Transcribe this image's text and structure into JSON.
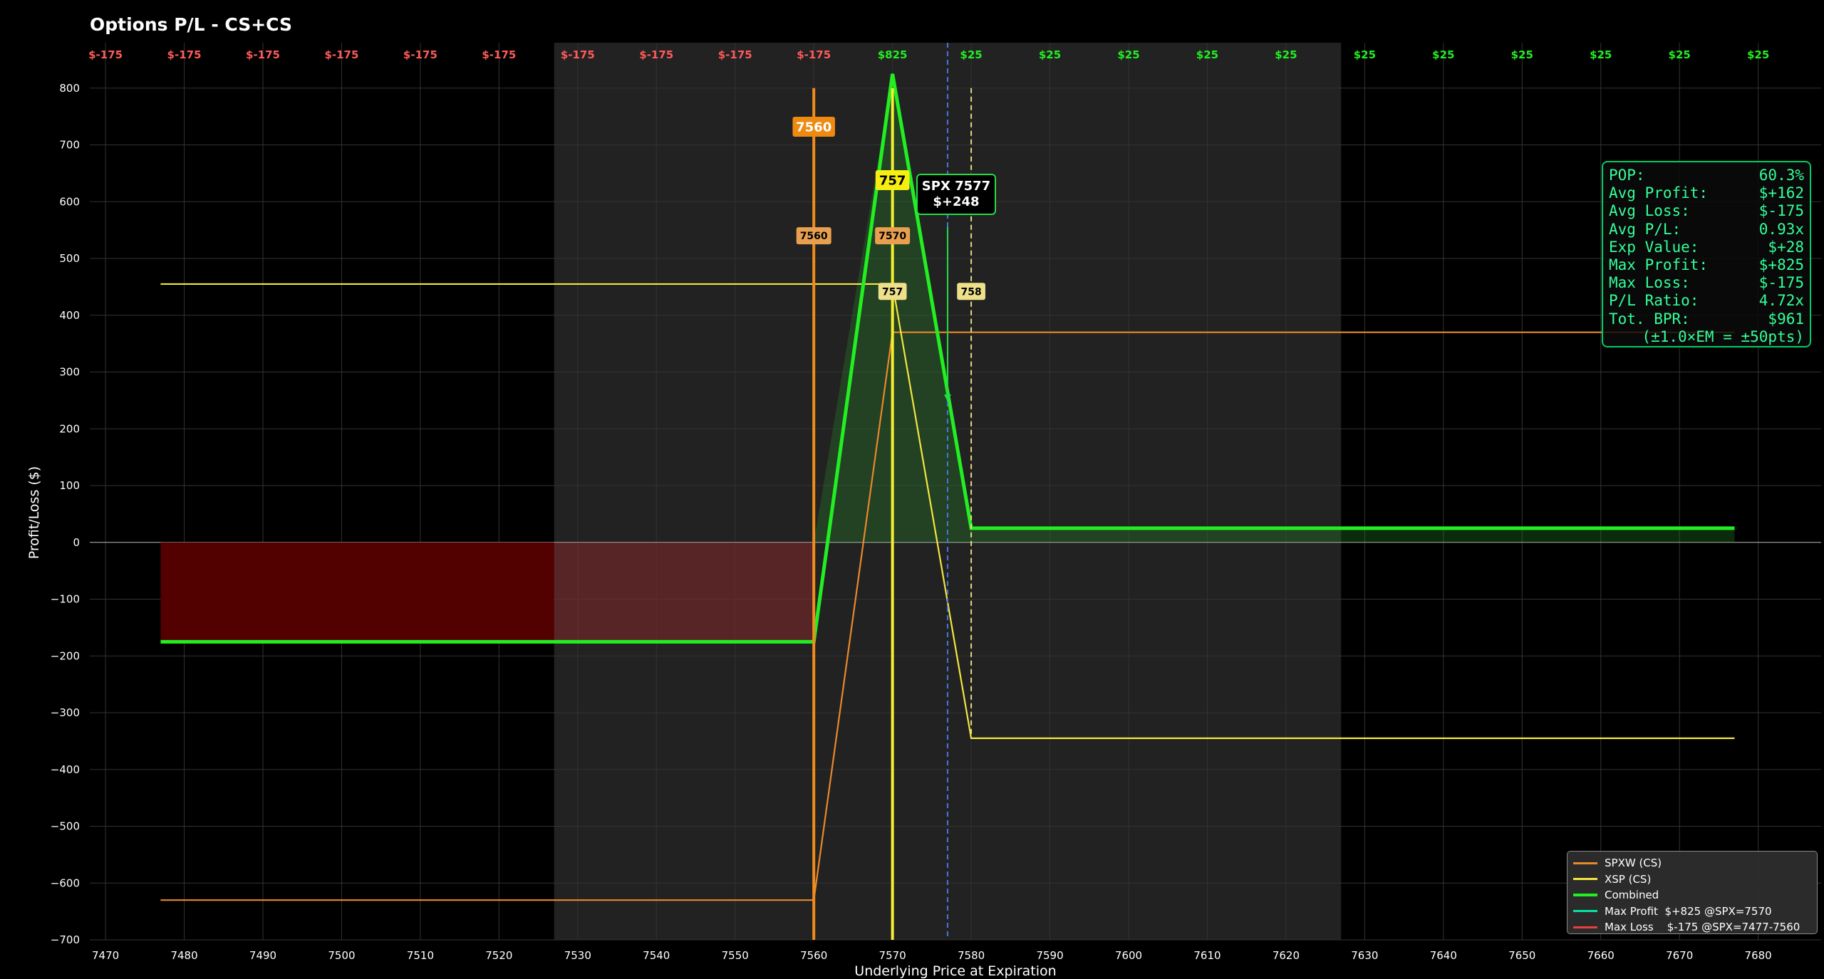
{
  "title": "Options P/L - CS+CS",
  "chart_data": {
    "type": "line",
    "xlabel": "Underlying Price at Expiration",
    "ylabel": "Profit/Loss ($)",
    "xlim": [
      7468,
      7688
    ],
    "ylim": [
      -700,
      880
    ],
    "grid": true,
    "x_ticks": [
      7470,
      7480,
      7490,
      7500,
      7510,
      7520,
      7530,
      7540,
      7550,
      7560,
      7570,
      7580,
      7590,
      7600,
      7610,
      7620,
      7630,
      7640,
      7650,
      7660,
      7670,
      7680
    ],
    "y_ticks": [
      800,
      700,
      600,
      500,
      400,
      300,
      200,
      100,
      0,
      -100,
      -200,
      -300,
      -400,
      -500,
      -600,
      -700
    ],
    "expected_move_range": [
      7527,
      7627
    ],
    "series": [
      {
        "name": "SPXW (CS)",
        "color": "#e8892a",
        "points": [
          [
            7477,
            -630
          ],
          [
            7560,
            -630
          ],
          [
            7570,
            370
          ],
          [
            7677,
            370
          ]
        ]
      },
      {
        "name": "XSP (CS)",
        "color": "#f2e640",
        "points": [
          [
            7477,
            455
          ],
          [
            7570,
            455
          ],
          [
            7580,
            -345
          ],
          [
            7677,
            -345
          ]
        ]
      },
      {
        "name": "Combined",
        "color": "#22ee22",
        "points": [
          [
            7477,
            -175
          ],
          [
            7560,
            -175
          ],
          [
            7570,
            825
          ],
          [
            7580,
            25
          ],
          [
            7677,
            25
          ]
        ]
      }
    ],
    "top_labels": [
      {
        "x": 7470,
        "text": "$-175"
      },
      {
        "x": 7480,
        "text": "$-175"
      },
      {
        "x": 7490,
        "text": "$-175"
      },
      {
        "x": 7500,
        "text": "$-175"
      },
      {
        "x": 7510,
        "text": "$-175"
      },
      {
        "x": 7520,
        "text": "$-175"
      },
      {
        "x": 7530,
        "text": "$-175"
      },
      {
        "x": 7540,
        "text": "$-175"
      },
      {
        "x": 7550,
        "text": "$-175"
      },
      {
        "x": 7560,
        "text": "$-175"
      },
      {
        "x": 7570,
        "text": "$825"
      },
      {
        "x": 7580,
        "text": "$25"
      },
      {
        "x": 7590,
        "text": "$25"
      },
      {
        "x": 7600,
        "text": "$25"
      },
      {
        "x": 7610,
        "text": "$25"
      },
      {
        "x": 7620,
        "text": "$25"
      },
      {
        "x": 7630,
        "text": "$25"
      },
      {
        "x": 7640,
        "text": "$25"
      },
      {
        "x": 7650,
        "text": "$25"
      },
      {
        "x": 7660,
        "text": "$25"
      },
      {
        "x": 7670,
        "text": "$25"
      },
      {
        "x": 7680,
        "text": "$25"
      }
    ],
    "strike_lines": [
      {
        "x": 7560,
        "color": "#f28c1e",
        "style": "solid"
      },
      {
        "x": 7570,
        "color": "#f5ee30",
        "style": "solid"
      },
      {
        "x": 7580,
        "color": "#e6dc80",
        "style": "dashed"
      },
      {
        "x": 7577,
        "color": "#4477dd",
        "style": "dashed"
      }
    ],
    "strike_tags": [
      {
        "x": 7560,
        "y": 732,
        "text": "7560",
        "bg": "#ee8a10",
        "fg": "#ffffff",
        "big": true
      },
      {
        "x": 7570,
        "y": 638,
        "text": "757",
        "bg": "#f5ee10",
        "fg": "#000000",
        "big": true
      },
      {
        "x": 7560,
        "y": 540,
        "text": "7560",
        "bg": "#e8a050",
        "fg": "#000000",
        "big": false
      },
      {
        "x": 7570,
        "y": 540,
        "text": "7570",
        "bg": "#e8a050",
        "fg": "#000000",
        "big": false
      },
      {
        "x": 7570,
        "y": 442,
        "text": "757",
        "bg": "#eee08a",
        "fg": "#000000",
        "big": false
      },
      {
        "x": 7580,
        "y": 442,
        "text": "758",
        "bg": "#eee08a",
        "fg": "#000000",
        "big": false
      }
    ],
    "hover_marker": {
      "x": 7577,
      "y": 248,
      "line1": "SPX 7577",
      "line2": "$+248"
    }
  },
  "stats": [
    {
      "label": "POP:",
      "value": "60.3%"
    },
    {
      "label": "Avg Profit:",
      "value": "$+162"
    },
    {
      "label": "Avg Loss:",
      "value": "$-175"
    },
    {
      "label": "Avg P/L:",
      "value": "0.93x"
    },
    {
      "label": "Exp Value:",
      "value": "$+28"
    },
    {
      "label": "Max Profit:",
      "value": "$+825"
    },
    {
      "label": "Max Loss:",
      "value": "$-175"
    },
    {
      "label": "P/L Ratio:",
      "value": "4.72x"
    },
    {
      "label": "Tot. BPR:",
      "value": "$961"
    }
  ],
  "stats_note": "(±1.0×EM = ±50pts)",
  "legend": [
    {
      "label": "SPXW (CS)",
      "color": "#e8892a"
    },
    {
      "label": "XSP (CS)",
      "color": "#f2e640"
    },
    {
      "label": "Combined",
      "color": "#22ee22"
    },
    {
      "label": "Max Profit  $+825 @SPX=7570",
      "color": "#00e5a0"
    },
    {
      "label": "Max Loss    $-175 @SPX=7477-7560",
      "color": "#e84040"
    }
  ]
}
